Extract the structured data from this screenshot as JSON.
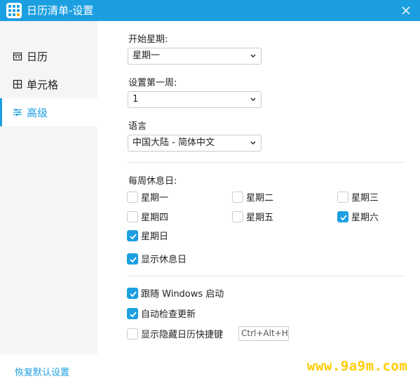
{
  "window": {
    "title": "日历清单-设置"
  },
  "colors": {
    "accent": "#1c9fe0",
    "sidebar_bg": "#f4f5f7",
    "watermark": "#ffcc00"
  },
  "sidebar": {
    "items": [
      {
        "label": "日历",
        "icon": "calendar-icon",
        "active": false
      },
      {
        "label": "单元格",
        "icon": "grid-icon",
        "active": false
      },
      {
        "label": "高级",
        "icon": "sliders-icon",
        "active": true
      }
    ]
  },
  "settings": {
    "week_start": {
      "label": "开始星期:",
      "value": "星期一"
    },
    "first_week": {
      "label": "设置第一周:",
      "value": "1"
    },
    "language": {
      "label": "语言",
      "value": "中国大陆 - 简体中文"
    },
    "weekend": {
      "label": "每周休息日:",
      "days": [
        {
          "label": "星期一",
          "checked": false
        },
        {
          "label": "星期二",
          "checked": false
        },
        {
          "label": "星期三",
          "checked": false
        },
        {
          "label": "星期四",
          "checked": false
        },
        {
          "label": "星期五",
          "checked": false
        },
        {
          "label": "星期六",
          "checked": true
        },
        {
          "label": "星期日",
          "checked": true
        }
      ]
    },
    "show_rest_days": {
      "label": "显示休息日",
      "checked": true
    },
    "autostart": {
      "label": "跟随 Windows 启动",
      "checked": true
    },
    "auto_update": {
      "label": "自动检查更新",
      "checked": true
    },
    "show_hide_hotkey": {
      "label": "显示隐藏日历快捷键",
      "checked": false,
      "hotkey": "Ctrl+Alt+H"
    }
  },
  "footer": {
    "restore_defaults": "恢复默认设置"
  },
  "watermark": "www.9a9m.com"
}
